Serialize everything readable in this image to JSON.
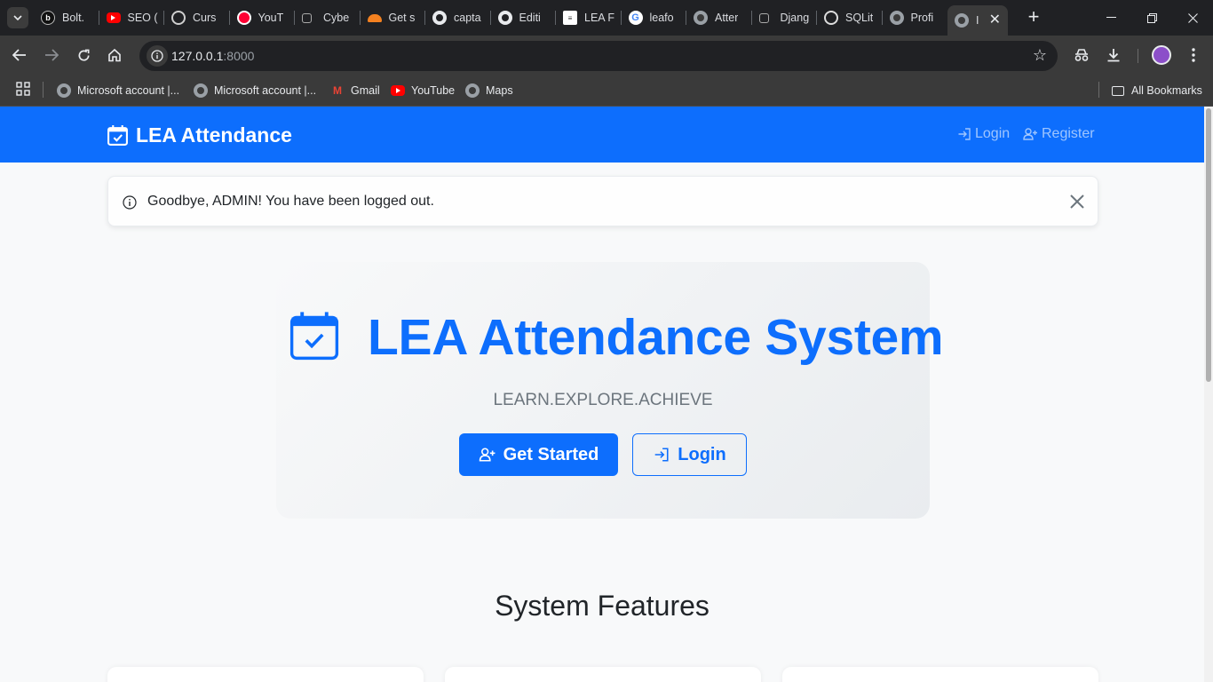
{
  "browser": {
    "tabs": [
      {
        "label": "Bolt.",
        "icon": "bolt-icon"
      },
      {
        "label": "SEO (",
        "icon": "youtube-icon"
      },
      {
        "label": "Curs",
        "icon": "chatgpt-icon"
      },
      {
        "label": "YouT",
        "icon": "youtube-icon"
      },
      {
        "label": "Cybe",
        "icon": "external-icon"
      },
      {
        "label": "Get s",
        "icon": "cloudflare-icon"
      },
      {
        "label": "capta",
        "icon": "github-icon"
      },
      {
        "label": "Editi",
        "icon": "github-icon"
      },
      {
        "label": "LEA F",
        "icon": "document-icon"
      },
      {
        "label": "leafo",
        "icon": "google-icon"
      },
      {
        "label": "Atter",
        "icon": "globe-icon"
      },
      {
        "label": "Djang",
        "icon": "external-icon"
      },
      {
        "label": "SQLit",
        "icon": "sqlite-icon"
      },
      {
        "label": "Profi",
        "icon": "globe-icon"
      },
      {
        "label": "I",
        "icon": "globe-icon",
        "active": true
      }
    ],
    "new_tab_label": "+",
    "url_host": "127.0.0.1",
    "url_port": ":8000",
    "bookmarks": [
      {
        "label": "Microsoft account |...",
        "icon": "globe-icon"
      },
      {
        "label": "Microsoft account |...",
        "icon": "globe-icon"
      },
      {
        "label": "Gmail",
        "icon": "gmail-icon"
      },
      {
        "label": "YouTube",
        "icon": "youtube-icon"
      },
      {
        "label": "Maps",
        "icon": "globe-icon"
      }
    ],
    "all_bookmarks_label": "All Bookmarks"
  },
  "navbar": {
    "brand": "LEA Attendance",
    "login_label": "Login",
    "register_label": "Register"
  },
  "alert": {
    "message": "Goodbye, ADMIN! You have been logged out."
  },
  "hero": {
    "title": "LEA Attendance System",
    "subtitle": "LEARN.EXPLORE.ACHIEVE",
    "primary_button": "Get Started",
    "secondary_button": "Login"
  },
  "features": {
    "title": "System Features"
  },
  "colors": {
    "primary": "#0d6efd",
    "page_bg": "#f8f9fa",
    "chrome_dark": "#202124",
    "chrome_toolbar": "#3a3a3a"
  }
}
